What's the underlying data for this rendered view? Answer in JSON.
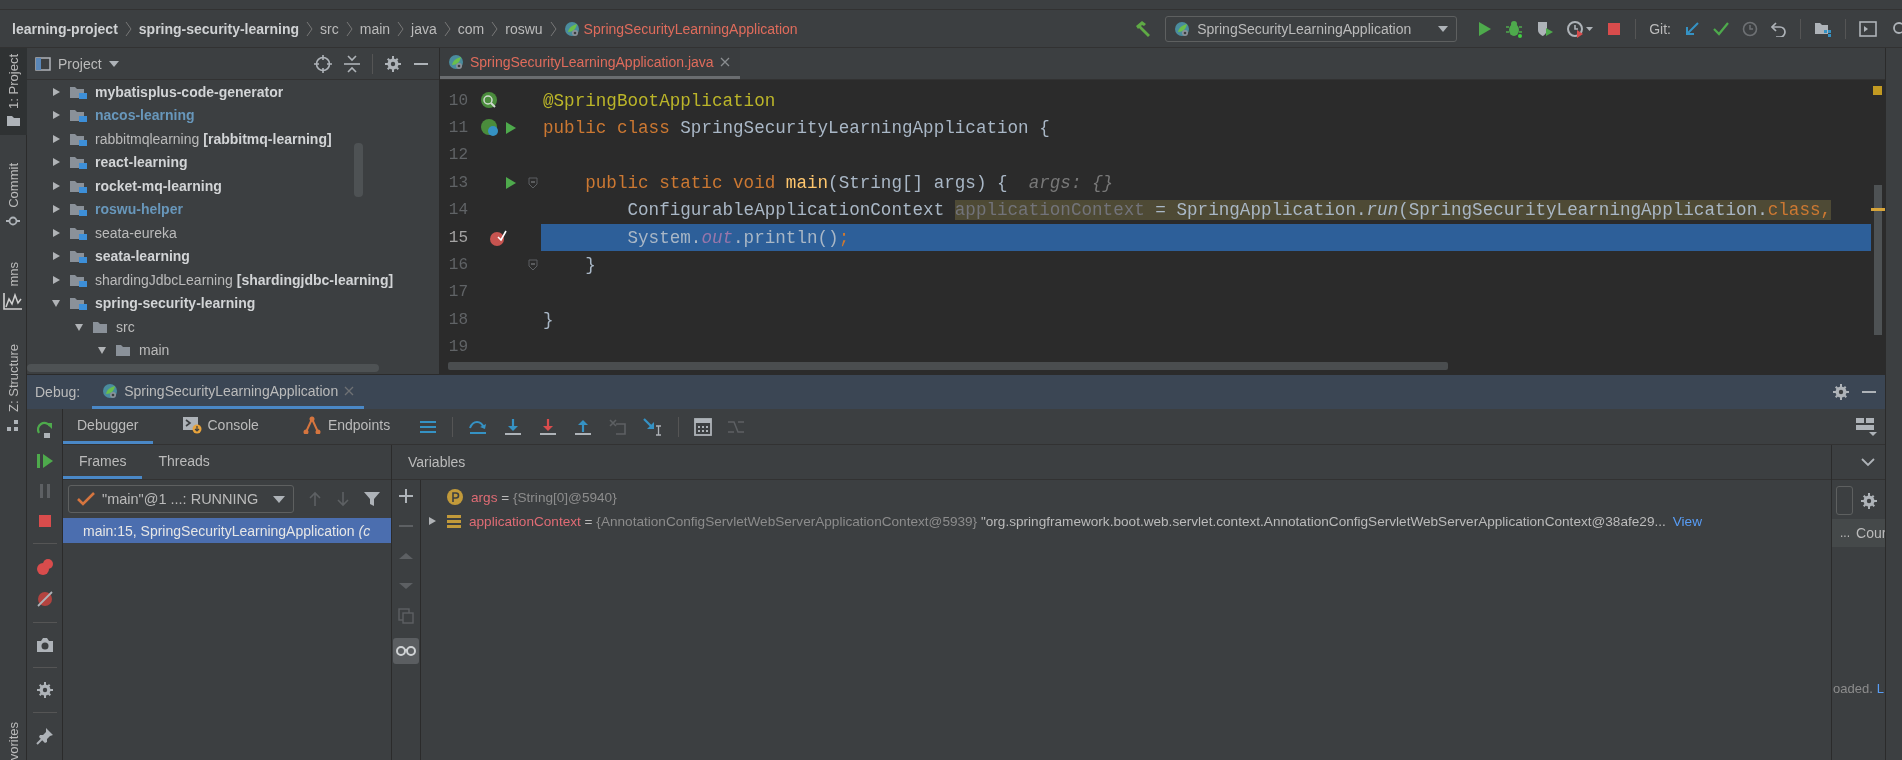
{
  "breadcrumbs": [
    {
      "label": "learning-project",
      "kind": "module"
    },
    {
      "label": "spring-security-learning",
      "kind": "module"
    },
    {
      "label": "src",
      "kind": "dir"
    },
    {
      "label": "main",
      "kind": "dir"
    },
    {
      "label": "java",
      "kind": "dir"
    },
    {
      "label": "com",
      "kind": "dir"
    },
    {
      "label": "roswu",
      "kind": "dir"
    },
    {
      "label": "SpringSecurityLearningApplication",
      "kind": "class"
    }
  ],
  "run_config": {
    "label": "SpringSecurityLearningApplication"
  },
  "git_label": "Git:",
  "side_tabs": [
    {
      "label": "1: Project",
      "selected": true
    },
    {
      "label": "Commit",
      "selected": false
    },
    {
      "label": "mns",
      "selected": false
    },
    {
      "label": "Z: Structure",
      "selected": false
    },
    {
      "label": "vorites",
      "selected": false
    }
  ],
  "project_panel": {
    "title": "Project",
    "tree": [
      {
        "name": "mybatisplus-code-generator",
        "bold": true,
        "color": "#d2d4d6",
        "expanded": false
      },
      {
        "name": "nacos-learning",
        "bold": true,
        "color": "#6897bb",
        "expanded": false
      },
      {
        "name": "rabbitmqlearning",
        "suffix": "[rabbitmq-learning]",
        "bold": false,
        "color": "#bbbbbb",
        "expanded": false
      },
      {
        "name": "react-learning",
        "bold": true,
        "color": "#d2d4d6",
        "expanded": false
      },
      {
        "name": "rocket-mq-learning",
        "bold": true,
        "color": "#d2d4d6",
        "expanded": false
      },
      {
        "name": "roswu-helper",
        "bold": true,
        "color": "#6897bb",
        "expanded": false
      },
      {
        "name": "seata-eureka",
        "bold": false,
        "color": "#bbbbbb",
        "expanded": false
      },
      {
        "name": "seata-learning",
        "bold": true,
        "color": "#d2d4d6",
        "expanded": false
      },
      {
        "name": "shardingJdbcLearning",
        "suffix": "[shardingjdbc-learning]",
        "bold": false,
        "color": "#bbbbbb",
        "expanded": false
      },
      {
        "name": "spring-security-learning",
        "bold": true,
        "color": "#d2d4d6",
        "expanded": true,
        "children": [
          {
            "name": "src",
            "bold": false,
            "color": "#bbbbbb",
            "expanded": true,
            "children": [
              {
                "name": "main",
                "bold": false,
                "color": "#bbbbbb",
                "expanded": true
              }
            ]
          }
        ]
      }
    ]
  },
  "editor": {
    "tab": {
      "label": "SpringSecurityLearningApplication.java",
      "selected": true
    },
    "lines": [
      {
        "number": "10",
        "kind": "bean",
        "current": false,
        "segments": [
          {
            "text": "@SpringBootApplication",
            "kind": "annotation"
          }
        ]
      },
      {
        "number": "11",
        "kind": "bean-run",
        "current": false,
        "segments": [
          {
            "text": "public class ",
            "kind": "keyword"
          },
          {
            "text": "SpringSecurityLearningApplication {",
            "kind": "plain"
          }
        ]
      },
      {
        "number": "12",
        "current": false
      },
      {
        "number": "13",
        "kind": "run",
        "fold": true,
        "current": false,
        "segments": [
          {
            "text": "    public static void ",
            "kind": "keyword"
          },
          {
            "text": "main",
            "kind": "method"
          },
          {
            "text": "(String[] args) {",
            "kind": "plain"
          },
          {
            "text": "  args: {}",
            "kind": "hint"
          }
        ]
      },
      {
        "number": "14",
        "current": false,
        "segments": [
          {
            "text": "        ConfigurableApplicationContext ",
            "kind": "plain"
          },
          {
            "text": "applicationContext",
            "kind": "unused"
          },
          {
            "text": " = SpringApplication.",
            "kind": "marked"
          },
          {
            "text": "run",
            "kind": "marked-italic"
          },
          {
            "text": "(SpringSecurityLearningApplication.",
            "kind": "marked"
          },
          {
            "text": "class,",
            "kind": "marked-keyword"
          }
        ]
      },
      {
        "number": "15",
        "kind": "breakpoint",
        "current": true,
        "segments": [
          {
            "text": "        System.",
            "kind": "plain"
          },
          {
            "text": "out",
            "kind": "static"
          },
          {
            "text": ".println()",
            "kind": "plain"
          },
          {
            "text": ";",
            "kind": "keyword"
          }
        ]
      },
      {
        "number": "16",
        "fold": true,
        "current": false,
        "segments": [
          {
            "text": "    }",
            "kind": "plain"
          }
        ]
      },
      {
        "number": "17",
        "current": false
      },
      {
        "number": "18",
        "current": false,
        "segments": [
          {
            "text": "}",
            "kind": "plain"
          }
        ]
      },
      {
        "number": "19",
        "current": false
      }
    ]
  },
  "debug": {
    "label": "Debug:",
    "session": {
      "label": "SpringSecurityLearningApplication",
      "selected": true
    },
    "tabs": [
      {
        "label": "Debugger",
        "selected": true
      },
      {
        "label": "Console",
        "selected": false
      },
      {
        "label": "Endpoints",
        "selected": false
      }
    ],
    "frame_tabs": [
      {
        "label": "Frames",
        "selected": true
      },
      {
        "label": "Threads",
        "selected": false
      }
    ],
    "thread": "\"main\"@1 ...: RUNNING",
    "frames": [
      {
        "label": "main:15, SpringSecurityLearningApplication",
        "suffix": "(c",
        "selected": true
      }
    ],
    "variables_title": "Variables",
    "variables": [
      {
        "name": "args",
        "kind": "param",
        "operator": "=",
        "value": "{String[0]@5940}",
        "has_children": false
      },
      {
        "name": "applicationContext",
        "kind": "field",
        "operator": "=",
        "value": "{AnnotationConfigServletWebServerApplicationContext@5939}",
        "text": "\"org.springframework.boot.web.servlet.context.AnnotationConfigServletWebServerApplicationContext@38afe29...",
        "link": "View",
        "has_children": true
      }
    ],
    "side_panel": {
      "row_marker": "...",
      "row_label": "Cour",
      "note": "oaded.",
      "note_link": "L"
    }
  }
}
